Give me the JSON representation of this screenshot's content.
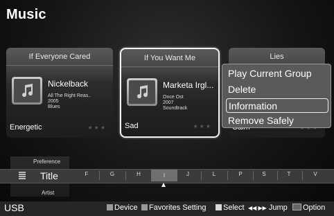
{
  "page_title": "Music",
  "cards": [
    {
      "title": "If Everyone Cared",
      "artist": "Nickelback",
      "meta": [
        "All The Right Reas..",
        "2005",
        "Blues"
      ],
      "mood": "Energetic",
      "stars": "★★★"
    },
    {
      "title": "If You Want Me",
      "artist": "Marketa Irgl...",
      "meta": [
        "Once Ost",
        "2007",
        "Soundtrack"
      ],
      "mood": "Sad",
      "stars": "★★★"
    },
    {
      "title": "Lies",
      "mood": "Calm",
      "stars": "★★★"
    }
  ],
  "context_menu": [
    "Play Current Group",
    "Delete",
    "Information",
    "Remove Safely"
  ],
  "sort": {
    "above": "Preference",
    "current": "Title",
    "below": "Artist"
  },
  "letters": [
    "F",
    "G",
    "H",
    "I",
    "J",
    "L",
    "P",
    "S",
    "T",
    "V"
  ],
  "footer": {
    "source": "USB",
    "device": "Device",
    "favorites": "Favorites Setting",
    "select": "Select",
    "jump_symbol": "◀◀ ▶▶",
    "jump": "Jump",
    "option": "Option"
  },
  "icons": {
    "album_art": "music-note-icon",
    "list": "list-icon",
    "option": "tools-icon"
  }
}
